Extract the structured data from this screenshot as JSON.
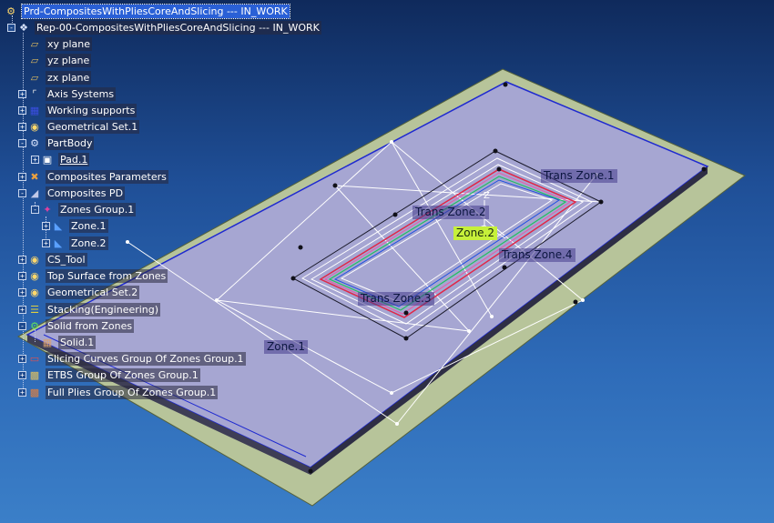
{
  "tree": {
    "root": "Prd-CompositesWithPliesCoreAndSlicing --- IN_WORK",
    "rep": "Rep-00-CompositesWithPliesCoreAndSlicing --- IN_WORK",
    "xy_plane": "xy plane",
    "yz_plane": "yz plane",
    "zx_plane": "zx plane",
    "axis_systems": "Axis Systems",
    "working_supports": "Working supports",
    "geometrical_set_1": "Geometrical Set.1",
    "partbody": "PartBody",
    "pad_1": "Pad.1",
    "composites_parameters": "Composites Parameters",
    "composites_pd": "Composites PD",
    "zones_group_1": "Zones Group.1",
    "zone_1": "Zone.1",
    "zone_2": "Zone.2",
    "cs_tool": "CS_Tool",
    "top_surface": "Top Surface from Zones",
    "geometrical_set_2": "Geometrical Set.2",
    "stacking": "Stacking(Engineering)",
    "solid_from_zones": "Solid from Zones",
    "solid_1": "Solid.1",
    "slicing_curves": "Slicing Curves Group Of Zones Group.1",
    "etbs_group": "ETBS Group Of Zones Group.1",
    "full_plies": "Full Plies Group Of Zones Group.1"
  },
  "viewport": {
    "trans_zone_1": "Trans Zone.1",
    "trans_zone_2": "Trans Zone.2",
    "trans_zone_3": "Trans Zone.3",
    "trans_zone_4": "Trans Zone.4",
    "zone_2_label": "Zone.2",
    "zone_1_label": "Zone.1"
  },
  "colors": {
    "background_top": "#0f2a5c",
    "background_bottom": "#3b7fc8",
    "plate_top": "#a6a6d2",
    "plate_base": "#b7c49a",
    "highlight_label": "#c6f03a",
    "selection": "#2a60d6"
  }
}
